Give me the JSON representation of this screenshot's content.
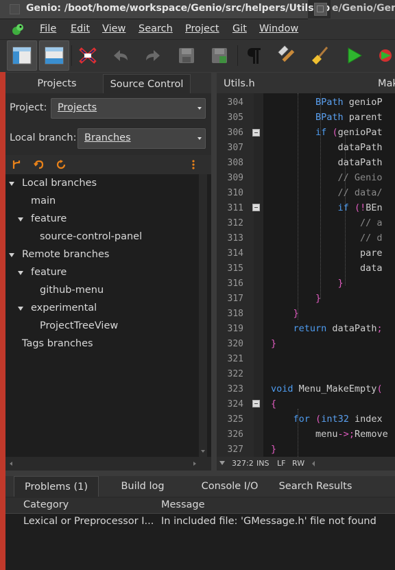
{
  "window": {
    "title": "Genio: /boot/home/workspace/Genio/src/helpers/Utils.cpp",
    "other_tab_title": "e/Genio/Genio"
  },
  "menu": {
    "items": [
      "File",
      "Edit",
      "View",
      "Search",
      "Project",
      "Git",
      "Window"
    ]
  },
  "toolbar": {
    "buttons": [
      "project-panel-icon",
      "output-panel-icon",
      "focus-mode-icon",
      "undo-icon",
      "redo-icon",
      "save-icon",
      "save-all-icon",
      "whitespace-icon",
      "build-icon",
      "clean-icon",
      "run-icon",
      "debug-icon"
    ]
  },
  "left_panel": {
    "tabs": [
      "Projects",
      "Source Control"
    ],
    "active_tab": "Source Control",
    "project_label": "Project:",
    "project_value": "Projects",
    "branch_label": "Local branch:",
    "branch_value": "Branches",
    "tree": [
      {
        "label": "Local branches",
        "level": 0,
        "expanded": true
      },
      {
        "label": "main",
        "level": 1,
        "expanded": null
      },
      {
        "label": "feature",
        "level": 1,
        "expanded": true
      },
      {
        "label": "source-control-panel",
        "level": 2,
        "expanded": null
      },
      {
        "label": "Remote branches",
        "level": 0,
        "expanded": true
      },
      {
        "label": "feature",
        "level": 1,
        "expanded": true
      },
      {
        "label": "github-menu",
        "level": 2,
        "expanded": null
      },
      {
        "label": "experimental",
        "level": 1,
        "expanded": true
      },
      {
        "label": "ProjectTreeView",
        "level": 2,
        "expanded": null
      },
      {
        "label": "Tags branches",
        "level": 0,
        "expanded": null
      }
    ]
  },
  "editor": {
    "tabs": [
      "Utils.h",
      "Mak"
    ],
    "lines": [
      {
        "n": "304",
        "text": "        BPath genioP"
      },
      {
        "n": "305",
        "text": "        BPath parent"
      },
      {
        "n": "306",
        "text": "        if (genioPat"
      },
      {
        "n": "307",
        "text": "            dataPath"
      },
      {
        "n": "308",
        "text": "            dataPath"
      },
      {
        "n": "309",
        "text": "            // Genio"
      },
      {
        "n": "310",
        "text": "            // data/"
      },
      {
        "n": "311",
        "text": "            if (!BEn"
      },
      {
        "n": "312",
        "text": "                // a"
      },
      {
        "n": "313",
        "text": "                // d"
      },
      {
        "n": "314",
        "text": "                pare"
      },
      {
        "n": "315",
        "text": "                data"
      },
      {
        "n": "316",
        "text": "            }"
      },
      {
        "n": "317",
        "text": "        }"
      },
      {
        "n": "318",
        "text": "    }"
      },
      {
        "n": "319",
        "text": "    return dataPath;"
      },
      {
        "n": "320",
        "text": "}"
      },
      {
        "n": "321",
        "text": ""
      },
      {
        "n": "322",
        "text": ""
      },
      {
        "n": "323",
        "text": "void Menu_MakeEmpty("
      },
      {
        "n": "324",
        "text": "{"
      },
      {
        "n": "325",
        "text": "    for (int32 index"
      },
      {
        "n": "326",
        "text": "        menu->Remove"
      },
      {
        "n": "327",
        "text": "}"
      }
    ],
    "status": {
      "position": "327:2",
      "mode": "INS",
      "eol": "LF",
      "access": "RW"
    }
  },
  "bottom_panel": {
    "tabs": [
      "Problems (1)",
      "Build log",
      "Console I/O",
      "Search Results"
    ],
    "active_tab": "Problems (1)",
    "columns": [
      "Category",
      "Message"
    ],
    "rows": [
      {
        "category": "Lexical or Preprocessor I...",
        "message": "In included file: 'GMessage.h' file not found"
      }
    ]
  }
}
